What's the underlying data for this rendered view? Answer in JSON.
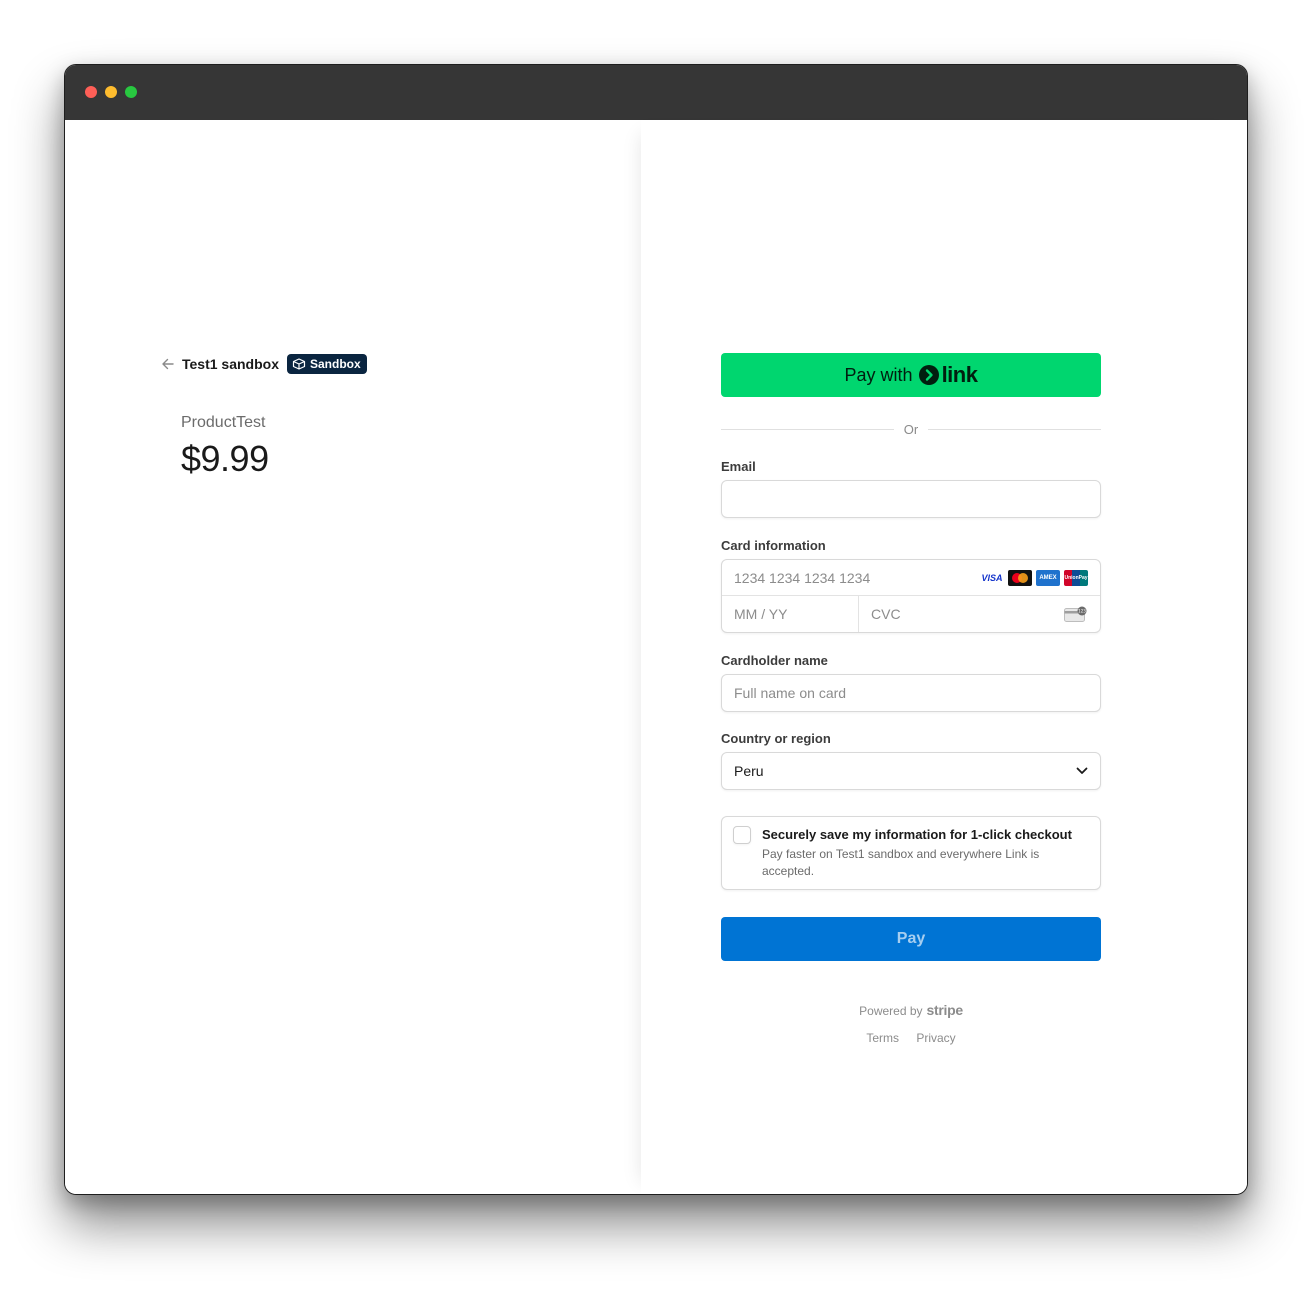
{
  "merchant": {
    "name": "Test1 sandbox",
    "badge": "Sandbox"
  },
  "product": {
    "name": "ProductTest",
    "price": "$9.99"
  },
  "link_button": {
    "prefix": "Pay with",
    "brand": "link"
  },
  "divider": "Or",
  "email": {
    "label": "Email",
    "placeholder": ""
  },
  "card": {
    "label": "Card information",
    "number_placeholder": "1234 1234 1234 1234",
    "expiry_placeholder": "MM / YY",
    "cvc_placeholder": "CVC",
    "brands": [
      "visa-icon",
      "mastercard-icon",
      "amex-icon",
      "unionpay-icon"
    ],
    "brand_text": {
      "visa": "VISA",
      "amex": "AMEX",
      "unionpay": "UnionPay"
    }
  },
  "cardholder": {
    "label": "Cardholder name",
    "placeholder": "Full name on card"
  },
  "country": {
    "label": "Country or region",
    "value": "Peru"
  },
  "save_info": {
    "title": "Securely save my information for 1-click checkout",
    "subtitle": "Pay faster on Test1 sandbox and everywhere Link is accepted."
  },
  "pay_button": "Pay",
  "footer": {
    "powered_by": "Powered by",
    "brand": "stripe",
    "links": [
      "Terms",
      "Privacy"
    ]
  },
  "colors": {
    "link_green": "#00d66f",
    "pay_blue": "#0074d4",
    "badge_navy": "#0a2540",
    "titlebar": "#363636"
  }
}
